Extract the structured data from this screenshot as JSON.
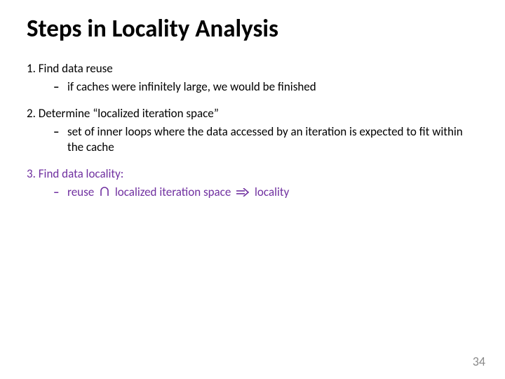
{
  "title": "Steps in Locality Analysis",
  "steps": [
    {
      "head": "1. Find data reuse",
      "bullets": [
        "if caches were infinitely large, we would be finished"
      ]
    },
    {
      "head": "2. Determine “localized iteration space”",
      "bullets": [
        "set of inner loops where the data accessed by an iteration is expected to fit within the cache"
      ]
    },
    {
      "head": "3. Find data locality:",
      "color": "#7030A0",
      "formula": [
        "reuse",
        "localized iteration space",
        "locality"
      ],
      "formula_symbols": [
        "intersection",
        "implies"
      ]
    }
  ],
  "page_number": "34"
}
